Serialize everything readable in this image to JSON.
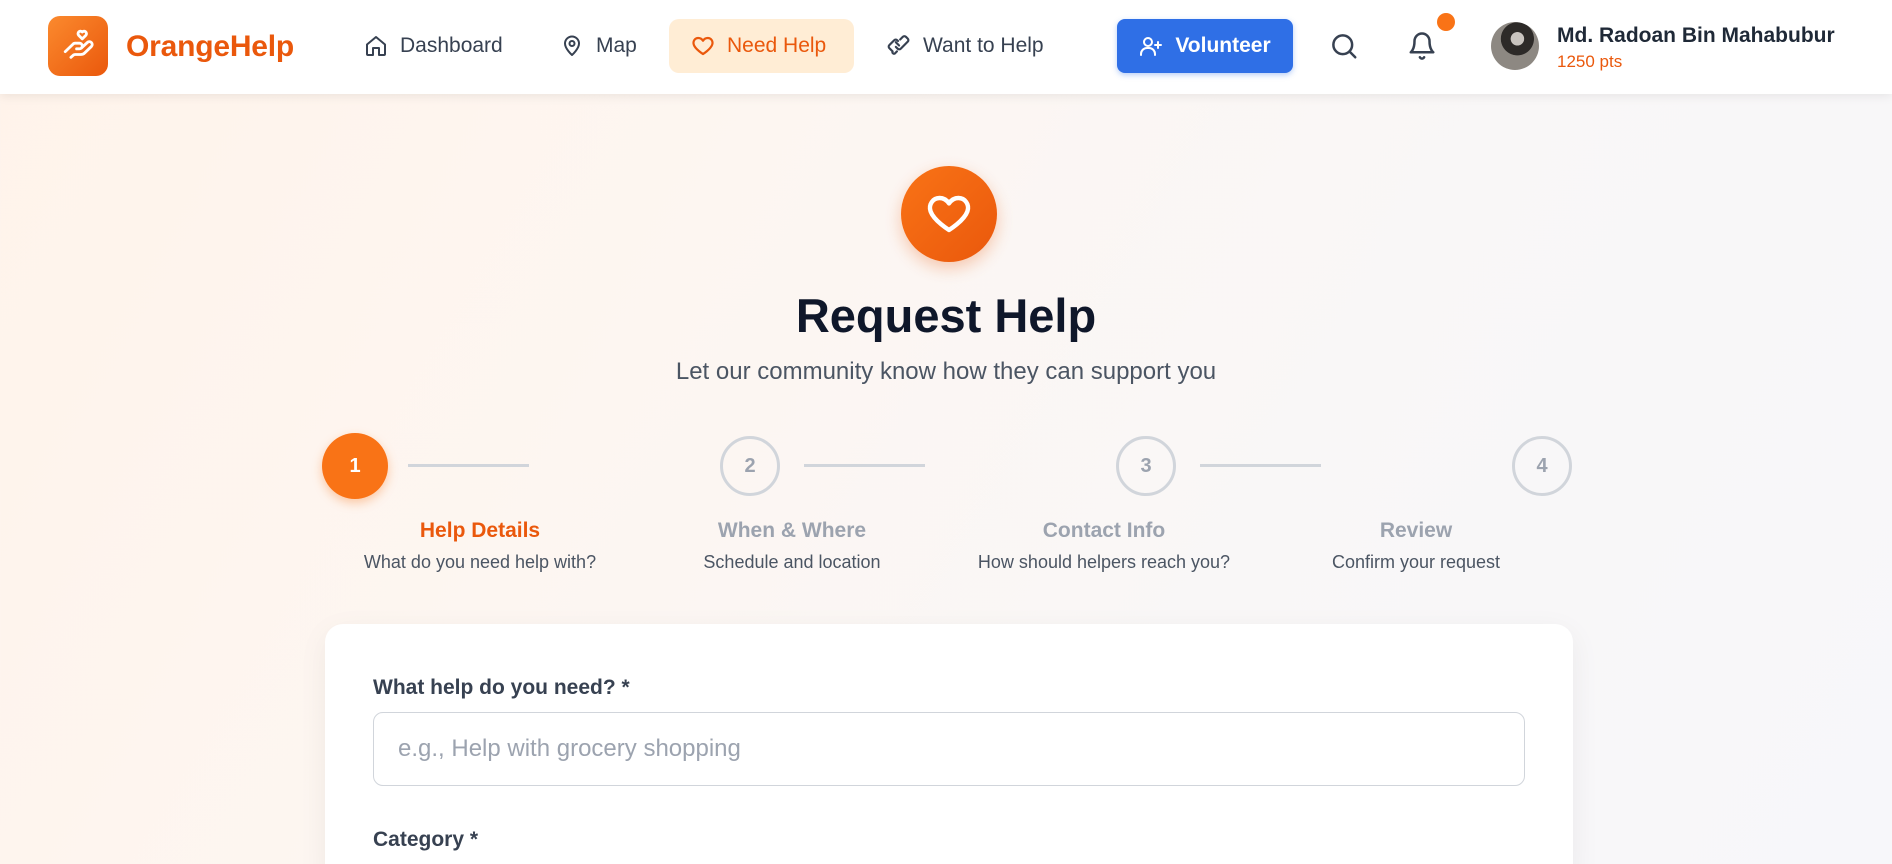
{
  "brand": {
    "name": "OrangeHelp",
    "icon": "hand-heart-icon"
  },
  "nav": {
    "dashboard": {
      "label": "Dashboard",
      "icon": "home-icon"
    },
    "map": {
      "label": "Map",
      "icon": "map-pin-icon"
    },
    "need_help": {
      "label": "Need Help",
      "icon": "heart-icon",
      "active": true
    },
    "want_to_help": {
      "label": "Want to Help",
      "icon": "handshake-icon"
    }
  },
  "volunteer_button": {
    "label": "Volunteer",
    "icon": "user-plus-icon"
  },
  "search": {
    "icon": "search-icon"
  },
  "notifications": {
    "icon": "bell-icon",
    "has_unread": true
  },
  "user": {
    "name": "Md. Radoan Bin Mahabubur",
    "points": "1250 pts"
  },
  "hero": {
    "icon": "heart-icon",
    "title": "Request Help",
    "subtitle": "Let our community know how they can support you"
  },
  "steps": [
    {
      "number": "1",
      "label": "Help Details",
      "description": "What do you need help with?",
      "active": true
    },
    {
      "number": "2",
      "label": "When & Where",
      "description": "Schedule and location",
      "active": false
    },
    {
      "number": "3",
      "label": "Contact Info",
      "description": "How should helpers reach you?",
      "active": false
    },
    {
      "number": "4",
      "label": "Review",
      "description": "Confirm your request",
      "active": false
    }
  ],
  "form": {
    "help_field": {
      "label": "What help do you need? *",
      "value": "",
      "placeholder": "e.g., Help with grocery shopping"
    },
    "category_field": {
      "label": "Category *"
    }
  },
  "colors": {
    "brand_orange": "#ea580c",
    "accent_orange": "#f97316",
    "active_nav_bg": "#ffedd5",
    "volunteer_blue": "#2f6fe6",
    "inactive_gray": "#9ca3af"
  }
}
